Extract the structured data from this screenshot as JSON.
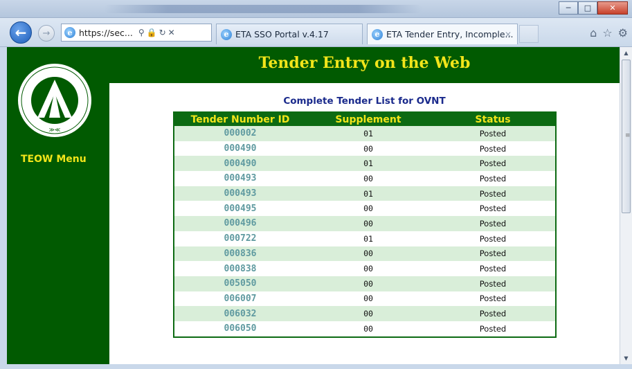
{
  "browser": {
    "address": {
      "url": "https://sec..."
    },
    "tabs": [
      {
        "label": "ETA SSO Portal v.4.17"
      },
      {
        "label": "ETA Tender Entry, Incomple..."
      }
    ]
  },
  "site": {
    "title": "Tender Entry on the Web",
    "menu_label": "TEOW Menu"
  },
  "list": {
    "title": "Complete Tender List for OVNT",
    "columns": [
      "Tender Number ID",
      "Supplement",
      "Status"
    ],
    "rows": [
      {
        "tender_id": "000002",
        "supplement": "01",
        "status": "Posted"
      },
      {
        "tender_id": "000490",
        "supplement": "00",
        "status": "Posted"
      },
      {
        "tender_id": "000490",
        "supplement": "01",
        "status": "Posted"
      },
      {
        "tender_id": "000493",
        "supplement": "00",
        "status": "Posted"
      },
      {
        "tender_id": "000493",
        "supplement": "01",
        "status": "Posted"
      },
      {
        "tender_id": "000495",
        "supplement": "00",
        "status": "Posted"
      },
      {
        "tender_id": "000496",
        "supplement": "00",
        "status": "Posted"
      },
      {
        "tender_id": "000722",
        "supplement": "01",
        "status": "Posted"
      },
      {
        "tender_id": "000836",
        "supplement": "00",
        "status": "Posted"
      },
      {
        "tender_id": "000838",
        "supplement": "00",
        "status": "Posted"
      },
      {
        "tender_id": "005050",
        "supplement": "00",
        "status": "Posted"
      },
      {
        "tender_id": "006007",
        "supplement": "00",
        "status": "Posted"
      },
      {
        "tender_id": "006032",
        "supplement": "00",
        "status": "Posted"
      },
      {
        "tender_id": "006050",
        "supplement": "00",
        "status": "Posted"
      }
    ]
  },
  "logo": {
    "ring_text": "MILITARY SURFACE DEPLOYMENT AND DISTRIBUTION COMMAND"
  },
  "colors": {
    "brand_green": "#015a01",
    "title_yellow": "#f2e51a",
    "row_alt": "#d9eed9",
    "link_teal": "#5f9aa0"
  },
  "icons": [
    "back-icon",
    "forward-icon",
    "ie-icon",
    "search-icon",
    "lock-icon",
    "refresh-icon",
    "stop-icon",
    "home-icon",
    "favorites-icon",
    "settings-icon",
    "minimize-icon",
    "maximize-icon",
    "close-icon"
  ]
}
